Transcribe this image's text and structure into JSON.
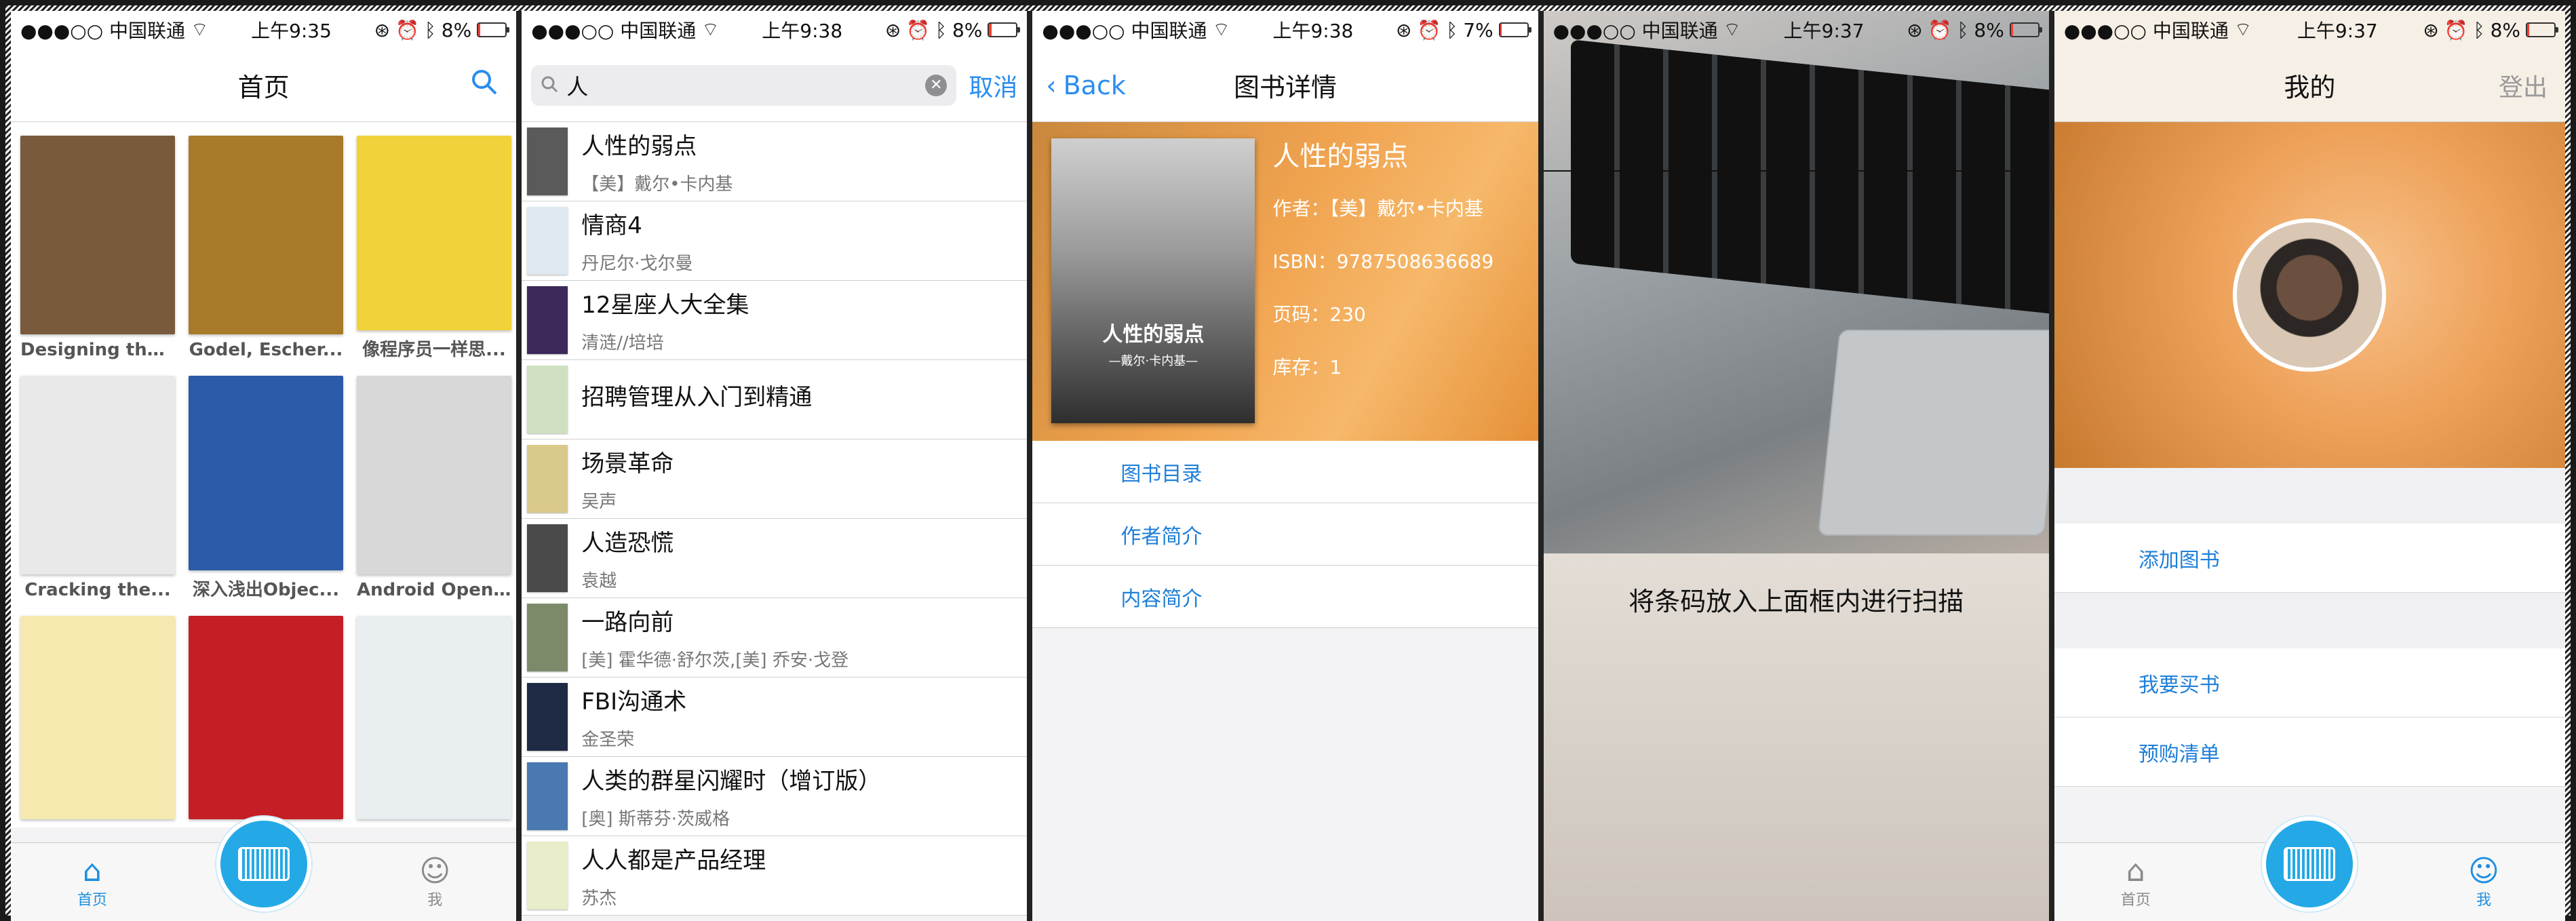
{
  "status_bars": [
    {
      "carrier": "●●●○○ 中国联通",
      "time": "上午9:35",
      "battery": "8%",
      "battery_level": 0.08
    },
    {
      "carrier": "●●●○○ 中国联通",
      "time": "上午9:38",
      "battery": "8%",
      "battery_level": 0.08
    },
    {
      "carrier": "●●●○○ 中国联通",
      "time": "上午9:38",
      "battery": "7%",
      "battery_level": 0.07
    },
    {
      "carrier": "●●●○○ 中国联通",
      "time": "上午9:37",
      "battery": "8%",
      "battery_level": 0.08
    },
    {
      "carrier": "●●●○○ 中国联通",
      "time": "上午9:37",
      "battery": "8%",
      "battery_level": 0.08
    }
  ],
  "home": {
    "title": "首页",
    "books": [
      {
        "title": "Designing the...",
        "color": "#7a5a3c"
      },
      {
        "title": "Godel, Escher...",
        "color": "#a77b2a"
      },
      {
        "title": "像程序员一样思...",
        "color": "#f0d23a"
      },
      {
        "title": "Cracking the...",
        "color": "#e9e9e9"
      },
      {
        "title": "深入浅出Objec...",
        "color": "#2a5aa8"
      },
      {
        "title": "Android Open...",
        "color": "#d8d8d8"
      },
      {
        "title": "",
        "color": "#f6e9b0"
      },
      {
        "title": "",
        "color": "#c41f24"
      },
      {
        "title": "",
        "color": "#e9eef0"
      }
    ]
  },
  "tabbar": {
    "home_label": "首页",
    "me_label": "我"
  },
  "search": {
    "query": "人",
    "cancel": "取消",
    "results": [
      {
        "title": "人性的弱点",
        "author": "【美】戴尔•卡内基",
        "color": "#5a5a5a"
      },
      {
        "title": "情商4",
        "author": "丹尼尔·戈尔曼",
        "color": "#dfe8ef"
      },
      {
        "title": "12星座人大全集",
        "author": "清涟//培培",
        "color": "#3b2a5a"
      },
      {
        "title": "招聘管理从入门到精通",
        "author": "",
        "color": "#cfe0c0"
      },
      {
        "title": "场景革命",
        "author": "吴声",
        "color": "#d9c98a"
      },
      {
        "title": "人造恐慌",
        "author": "袁越",
        "color": "#4a4a4a"
      },
      {
        "title": "一路向前",
        "author": "[美] 霍华德·舒尔茨,[美] 乔安·戈登",
        "color": "#7c8a6a"
      },
      {
        "title": "FBI沟通术",
        "author": "金圣荣",
        "color": "#1f2a44"
      },
      {
        "title": "人类的群星闪耀时（增订版）",
        "author": "[奥] 斯蒂芬·茨威格",
        "color": "#4a78b0"
      },
      {
        "title": "人人都是产品经理",
        "author": "苏杰",
        "color": "#e9edc9"
      }
    ]
  },
  "detail": {
    "back": "Back",
    "title": "图书详情",
    "cover_title": "人性的弱点",
    "cover_sub": "—戴尔·卡内基—",
    "book_title": "人性的弱点",
    "author": "作者：【美】戴尔•卡内基",
    "isbn": "ISBN：9787508636689",
    "pages": "页码：230",
    "stock": "库存：1",
    "menu": [
      "图书目录",
      "作者简介",
      "内容简介"
    ]
  },
  "scanner": {
    "close": "✘",
    "hint": "将条码放入上面框内进行扫描"
  },
  "mine": {
    "title": "我的",
    "logout": "登出",
    "items_a": [
      "添加图书"
    ],
    "items_b": [
      "我要买书",
      "预购清单"
    ]
  }
}
